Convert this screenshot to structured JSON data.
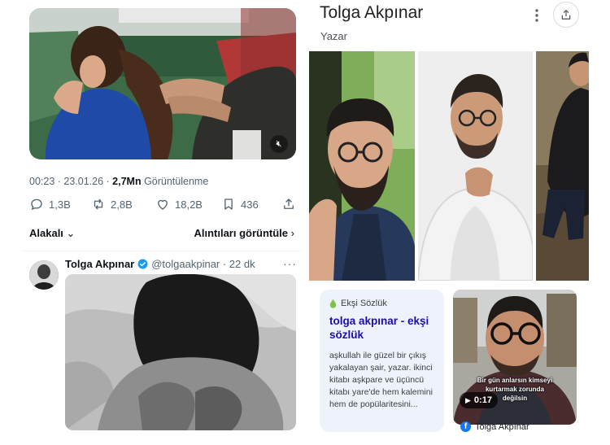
{
  "tweet": {
    "media": {
      "icon": "speaker-muted-icon"
    },
    "timestamp": "00:23 · 23.01.26 · ",
    "views_count": "2,7Mn",
    "views_label": " Görüntülenme",
    "actions": {
      "replies": "1,3B",
      "reposts": "2,8B",
      "likes": "18,2B",
      "bookmarks": "436"
    },
    "relevance_label": "Alakalı",
    "quotes_label": "Alıntıları görüntüle"
  },
  "reply": {
    "author_name": "Tolga Akpınar",
    "handle_time": "@tolgaakpinar · 22 dk",
    "more": "···"
  },
  "knowledge_panel": {
    "title": "Tolga Akpınar",
    "subtitle": "Yazar"
  },
  "result_card": {
    "source": "Ekşi Sözlük",
    "title": "tolga akpınar - ekşi sözlük",
    "snippet": "aşkullah ile güzel bir çıkış yakalayan şair, yazar. ikinci kitabı aşkpare ve üçüncü kitabı yare'de hem kalemini hem de popülaritesini..."
  },
  "video_card": {
    "caption_line1": "Bir gün anlarsın kimseyi",
    "caption_line2": "kurtarmak zorunda",
    "caption_line3": "değilsin",
    "duration": "0:17",
    "source": "Tolga Akpınar"
  },
  "colors": {
    "link_blue": "#1a0dab",
    "verified_blue": "#1d9bf0",
    "muted_gray": "#536471",
    "card_bg": "#eef3fb"
  }
}
